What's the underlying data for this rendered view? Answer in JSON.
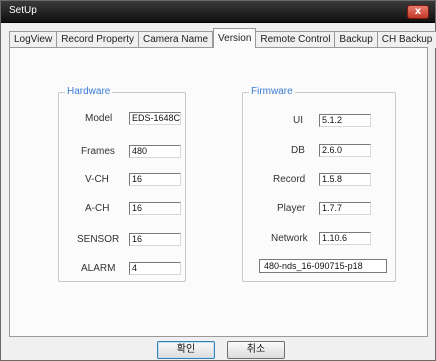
{
  "window": {
    "title": "SetUp",
    "close_symbol": "x"
  },
  "tabs": [
    {
      "label": "LogView",
      "active": false
    },
    {
      "label": "Record Property",
      "active": false
    },
    {
      "label": "Camera Name",
      "active": false
    },
    {
      "label": "Version",
      "active": true
    },
    {
      "label": "Remote Control",
      "active": false
    },
    {
      "label": "Backup",
      "active": false
    },
    {
      "label": "CH Backup",
      "active": false
    }
  ],
  "hardware": {
    "title": "Hardware",
    "fields": [
      {
        "label": "Model",
        "value": "EDS-1648C"
      },
      {
        "label": "Frames",
        "value": "480"
      },
      {
        "label": "V-CH",
        "value": "16"
      },
      {
        "label": "A-CH",
        "value": "16"
      },
      {
        "label": "SENSOR",
        "value": "16"
      },
      {
        "label": "ALARM",
        "value": "4"
      }
    ]
  },
  "firmware": {
    "title": "Firmware",
    "fields": [
      {
        "label": "UI",
        "value": "5.1.2"
      },
      {
        "label": "DB",
        "value": "2.6.0"
      },
      {
        "label": "Record",
        "value": "1.5.8"
      },
      {
        "label": "Player",
        "value": "1.7.7"
      },
      {
        "label": "Network",
        "value": "1.10.6"
      }
    ],
    "version_string": "480-nds_16-090715-p18"
  },
  "buttons": {
    "ok": "확인",
    "cancel": "취소"
  }
}
